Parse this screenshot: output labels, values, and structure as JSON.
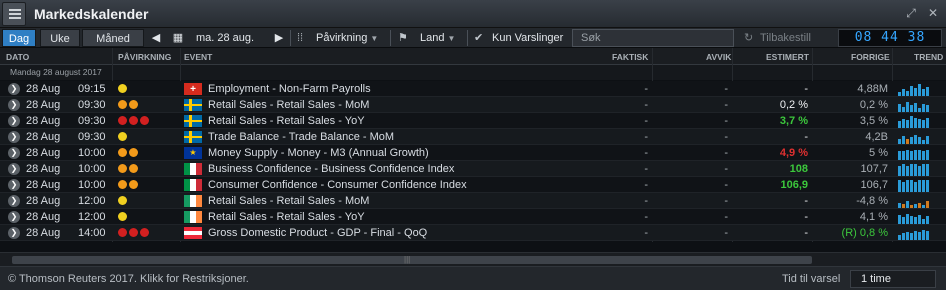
{
  "window": {
    "title": "Markedskalender"
  },
  "toolbar": {
    "tab_day": "Dag",
    "tab_week": "Uke",
    "tab_month": "Måned",
    "date": "ma. 28 aug.",
    "impact_label": "Påvirkning",
    "country_label": "Land",
    "alerts_label": "Kun Varslinger",
    "search_placeholder": "Søk",
    "reset_label": "Tilbakestill",
    "clock": "08 44 38"
  },
  "columns": {
    "date": "DATO",
    "impact": "PÅVIRKNING",
    "event": "EVENT",
    "actual": "FAKTISK",
    "deviation": "AVVIK",
    "estimate": "ESTIMERT",
    "previous": "FORRIGE",
    "trend": "TREND"
  },
  "group_label": "Mandag 28 august 2017",
  "colors": {
    "accent": "#2f7fc4",
    "clock": "#35a6ff",
    "positive": "#3cc83c",
    "negative": "#e03030",
    "impact_orange": "#f29a1a",
    "impact_yellow": "#f0d020",
    "impact_red": "#d22020"
  },
  "rows": [
    {
      "date": "28 Aug",
      "time": "09:15",
      "impact": [
        "yellow"
      ],
      "flag": "ch",
      "event": "Employment - Non-Farm Payrolls",
      "actual": "-",
      "deviation": "-",
      "estimate": "-",
      "estimate_color": "",
      "previous": "4,88M",
      "previous_color": "",
      "trend": [
        0.3,
        0.5,
        0.4,
        0.8,
        0.6,
        0.9,
        0.5,
        0.7
      ]
    },
    {
      "date": "28 Aug",
      "time": "09:30",
      "impact": [
        "orange",
        "orange"
      ],
      "flag": "se",
      "event": "Retail Sales - Retail Sales - MoM",
      "actual": "-",
      "deviation": "-",
      "estimate": "0,2 %",
      "estimate_color": "",
      "previous": "0,2 %",
      "previous_color": "",
      "trend": [
        0.6,
        0.4,
        0.8,
        0.5,
        0.7,
        0.3,
        0.6,
        0.5
      ]
    },
    {
      "date": "28 Aug",
      "time": "09:30",
      "impact": [
        "red",
        "red",
        "red"
      ],
      "flag": "se",
      "event": "Retail Sales - Retail Sales - YoY",
      "actual": "-",
      "deviation": "-",
      "estimate": "3,7 %",
      "estimate_color": "positive",
      "previous": "3,5 %",
      "previous_color": "",
      "trend": [
        0.5,
        0.7,
        0.6,
        0.9,
        0.8,
        0.7,
        0.6,
        0.8
      ]
    },
    {
      "date": "28 Aug",
      "time": "09:30",
      "impact": [
        "yellow"
      ],
      "flag": "se",
      "event": "Trade Balance - Trade Balance - MoM",
      "actual": "-",
      "deviation": "-",
      "estimate": "-",
      "estimate_color": "",
      "previous": "4,2B",
      "previous_color": "",
      "trend": [
        0.4,
        0.6,
        -0.4,
        0.5,
        0.7,
        0.5,
        0.3,
        0.6
      ]
    },
    {
      "date": "28 Aug",
      "time": "10:00",
      "impact": [
        "orange",
        "orange"
      ],
      "flag": "eu",
      "event": "Money Supply - Money - M3 (Annual Growth)",
      "actual": "-",
      "deviation": "-",
      "estimate": "4,9 %",
      "estimate_color": "negative",
      "previous": "5 %",
      "previous_color": "",
      "trend": [
        0.7,
        0.7,
        0.8,
        0.7,
        0.8,
        0.8,
        0.7,
        0.8
      ]
    },
    {
      "date": "28 Aug",
      "time": "10:00",
      "impact": [
        "orange",
        "orange"
      ],
      "flag": "it",
      "event": "Business Confidence - Business Confidence Index",
      "actual": "-",
      "deviation": "-",
      "estimate": "108",
      "estimate_color": "positive",
      "previous": "107,7",
      "previous_color": "",
      "trend": [
        0.8,
        0.9,
        0.8,
        0.9,
        0.9,
        0.8,
        0.9,
        0.9
      ]
    },
    {
      "date": "28 Aug",
      "time": "10:00",
      "impact": [
        "orange",
        "orange"
      ],
      "flag": "it",
      "event": "Consumer Confidence - Consumer Confidence Index",
      "actual": "-",
      "deviation": "-",
      "estimate": "106,9",
      "estimate_color": "positive",
      "previous": "106,7",
      "previous_color": "",
      "trend": [
        0.9,
        0.8,
        0.9,
        0.9,
        0.8,
        0.9,
        0.9,
        0.9
      ]
    },
    {
      "date": "28 Aug",
      "time": "12:00",
      "impact": [
        "yellow"
      ],
      "flag": "ie",
      "event": "Retail Sales - Retail Sales - MoM",
      "actual": "-",
      "deviation": "-",
      "estimate": "-",
      "estimate_color": "",
      "previous": "-4,8 %",
      "previous_color": "",
      "trend": [
        0.4,
        -0.3,
        0.5,
        -0.2,
        0.3,
        -0.4,
        0.2,
        -0.5
      ]
    },
    {
      "date": "28 Aug",
      "time": "12:00",
      "impact": [
        "yellow"
      ],
      "flag": "ie",
      "event": "Retail Sales - Retail Sales - YoY",
      "actual": "-",
      "deviation": "-",
      "estimate": "-",
      "estimate_color": "",
      "previous": "4,1 %",
      "previous_color": "",
      "trend": [
        0.7,
        0.5,
        0.8,
        0.6,
        0.5,
        0.7,
        0.4,
        0.6
      ]
    },
    {
      "date": "28 Aug",
      "time": "14:00",
      "impact": [
        "red",
        "red",
        "red"
      ],
      "flag": "at",
      "event": "Gross Domestic Product - GDP - Final - QoQ",
      "actual": "-",
      "deviation": "-",
      "estimate": "-",
      "estimate_color": "",
      "previous": "(R) 0,8 %",
      "previous_color": "positive",
      "trend": [
        0.4,
        0.5,
        0.6,
        0.5,
        0.7,
        0.6,
        0.8,
        0.7
      ]
    }
  ],
  "footer": {
    "copyright": "© Thomson Reuters 2017. Klikk for Restriksjoner.",
    "notify_label": "Tid til varsel",
    "notify_value": "1 time"
  }
}
